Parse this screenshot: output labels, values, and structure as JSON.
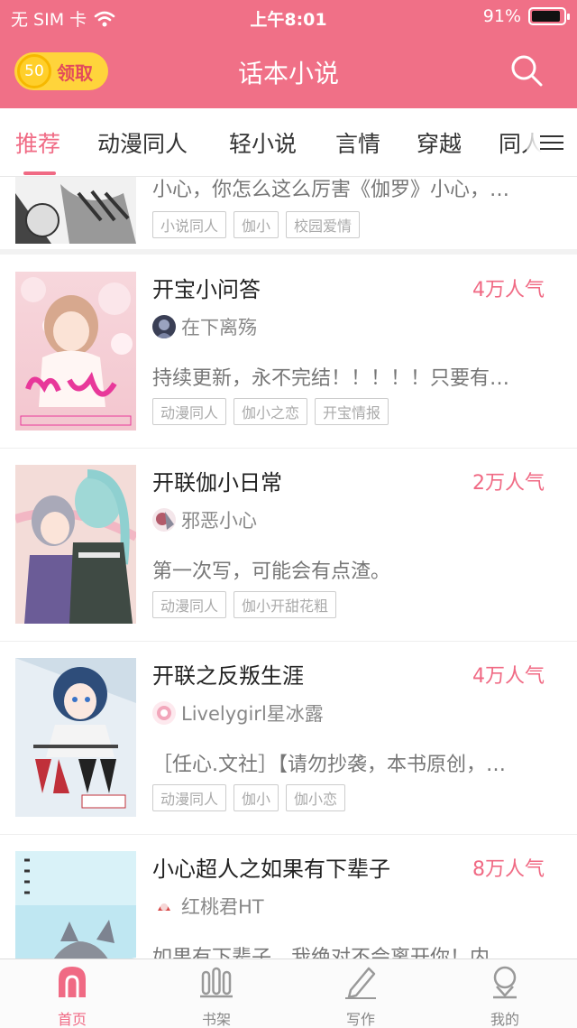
{
  "status_bar": {
    "carrier": "无 SIM 卡",
    "time": "上午8:01",
    "battery": "91%",
    "battery_level": 0.91
  },
  "header": {
    "coin_value": "50",
    "claim_label": "领取",
    "title": "话本小说",
    "search_icon": "search-icon"
  },
  "tabs": {
    "items": [
      {
        "label": "推荐",
        "active": true
      },
      {
        "label": "动漫同人"
      },
      {
        "label": "轻小说"
      },
      {
        "label": "言情"
      },
      {
        "label": "穿越"
      },
      {
        "label": "同人"
      }
    ],
    "more_icon": "menu-icon"
  },
  "stories": [
    {
      "title": "",
      "hot": "",
      "author": "",
      "desc": "小心，你怎么这么厉害《伽罗》小心，…",
      "tags": [
        "小说同人",
        "伽小",
        "校园爱情"
      ]
    },
    {
      "title": "开宝小问答",
      "hot": "4万人气",
      "author": "在下离殇",
      "desc": "持续更新，永不完结！！！！！只要有…",
      "tags": [
        "动漫同人",
        "伽小之恋",
        "开宝情报"
      ]
    },
    {
      "title": "开联伽小日常",
      "hot": "2万人气",
      "author": "邪恶小心",
      "desc": "第一次写，可能会有点渣。",
      "tags": [
        "动漫同人",
        "伽小开甜花粗"
      ]
    },
    {
      "title": "开联之反叛生涯",
      "hot": "4万人气",
      "author": "Livelygirl星冰露",
      "desc": "［任心.文社］【请勿抄袭，本书原创，…",
      "tags": [
        "动漫同人",
        "伽小",
        "伽小恋"
      ]
    },
    {
      "title": "小心超人之如果有下辈子",
      "hot": "8万人气",
      "author": "红桃君HT",
      "desc": "如果有下辈子，我绝对不会离开你！内…",
      "tags": []
    }
  ],
  "bottom_nav": [
    {
      "label": "首页",
      "icon": "home-icon",
      "active": true
    },
    {
      "label": "书架",
      "icon": "bookshelf-icon"
    },
    {
      "label": "写作",
      "icon": "pen-icon"
    },
    {
      "label": "我的",
      "icon": "profile-icon"
    }
  ],
  "colors": {
    "accent": "#f06a84",
    "header_bg": "#f07087",
    "coin": "#ffd43b"
  }
}
